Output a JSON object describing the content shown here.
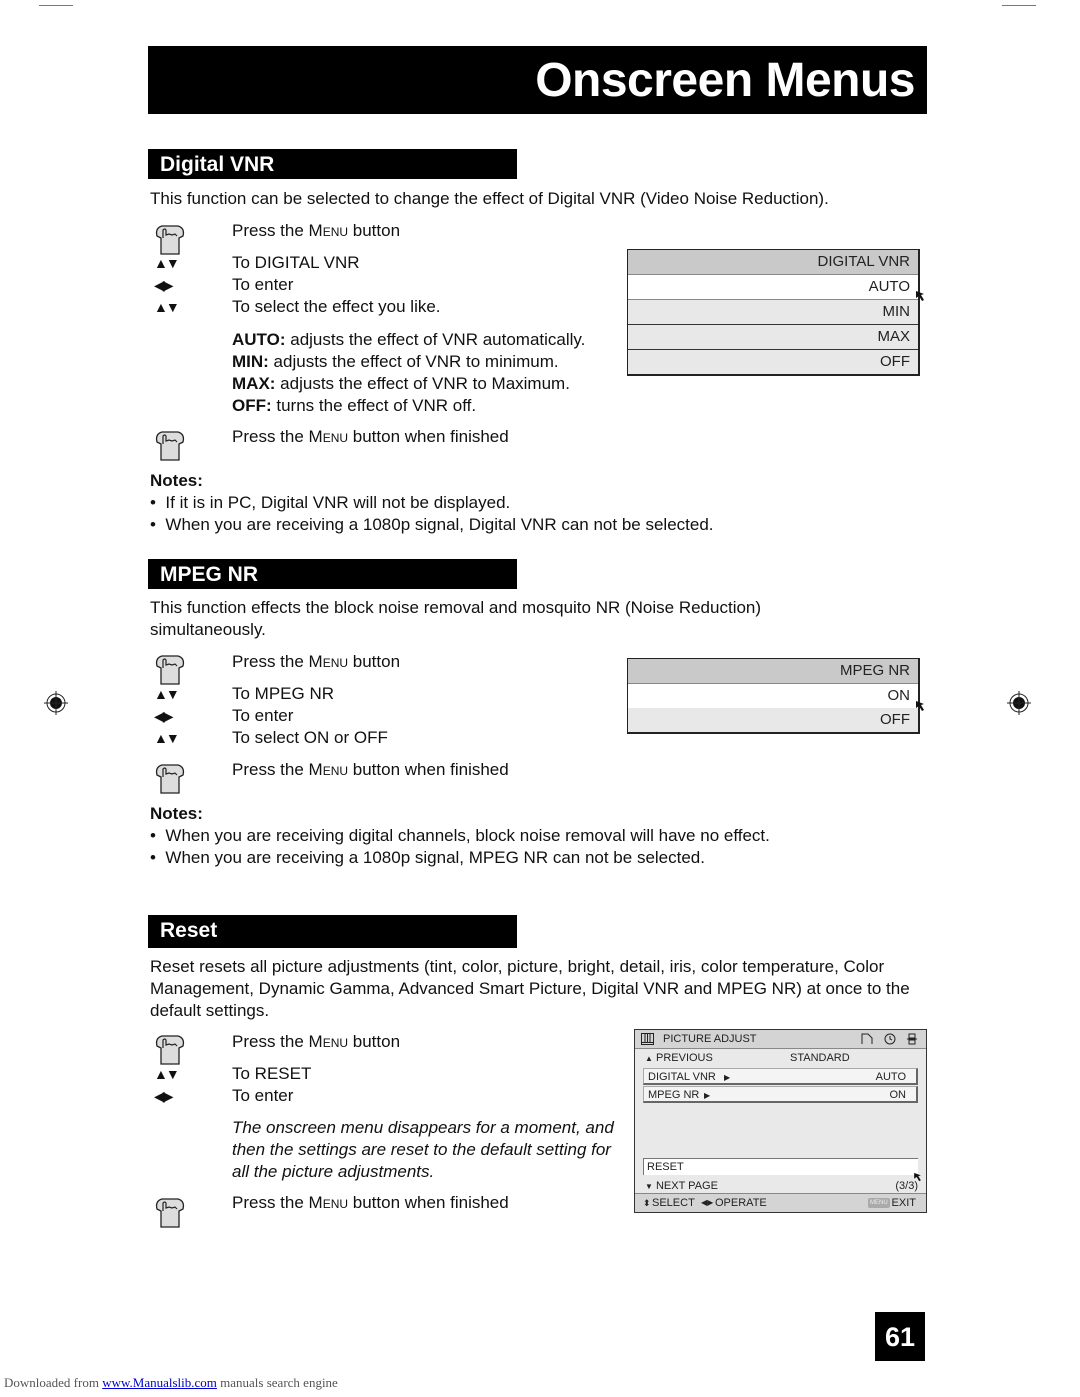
{
  "page": {
    "title": "Onscreen Menus",
    "page_number": "61",
    "footer": {
      "prefix": "Downloaded from ",
      "link": "www.Manualslib.com",
      "suffix": " manuals search engine"
    }
  },
  "common": {
    "press_menu_pre": "Press the ",
    "menu_word": "Menu",
    "press_menu_post": " button",
    "press_menu_finished_post": " button when finished",
    "to_enter": "To enter",
    "notes_heading": "Notes:",
    "bullet": "•"
  },
  "digital_vnr": {
    "heading": "Digital VNR",
    "intro": "This function can be selected to change the effect of Digital VNR (Video Noise Reduction).",
    "step_to": "To DIGITAL VNR",
    "step_select": "To select the effect you like.",
    "options": [
      {
        "term": "AUTO:",
        "desc": " adjusts the effect of VNR automatically."
      },
      {
        "term": "MIN:",
        "desc": " adjusts the effect of VNR to minimum."
      },
      {
        "term": "MAX:",
        "desc": " adjusts the effect of VNR to Maximum."
      },
      {
        "term": "OFF:",
        "desc": " turns the effect of VNR off."
      }
    ],
    "notes": [
      "If it is in PC, Digital VNR will not be displayed.",
      "When you are receiving a 1080p signal, Digital VNR can not be selected."
    ],
    "osd": {
      "title": "DIGITAL VNR",
      "items": [
        "AUTO",
        "MIN",
        "MAX",
        "OFF"
      ],
      "highlighted": "AUTO"
    }
  },
  "mpeg_nr": {
    "heading": "MPEG NR",
    "intro": "This function effects the block noise removal and mosquito NR (Noise Reduction) simultaneously.",
    "step_to": "To MPEG NR",
    "step_select": "To select ON or OFF",
    "notes": [
      "When you are receiving digital channels, block noise removal will have no effect.",
      "When you are receiving a 1080p signal, MPEG NR can not be selected."
    ],
    "osd": {
      "title": "MPEG NR",
      "items": [
        "ON",
        "OFF"
      ],
      "highlighted": "ON"
    }
  },
  "reset": {
    "heading": "Reset",
    "intro": "Reset resets all picture adjustments (tint, color, picture, bright, detail, iris, color temperature, Color Management, Dynamic Gamma, Advanced Smart Picture, Digital VNR and MPEG NR) at once to the default settings.",
    "step_to": "To RESET",
    "italic_note": "The onscreen menu disappears for a moment, and then the settings are reset to the default setting for all the picture adjustments.",
    "osd": {
      "title": "PICTURE ADJUST",
      "previous_label": "PREVIOUS",
      "previous_value": "STANDARD",
      "rows": [
        {
          "label": "DIGITAL VNR",
          "value": "AUTO"
        },
        {
          "label": "MPEG NR",
          "value": "ON"
        }
      ],
      "reset_label": "RESET",
      "next_page": "NEXT PAGE",
      "page_indicator": "(3/3)",
      "select_label": "SELECT",
      "operate_label": "OPERATE",
      "menu_badge": "MENU",
      "exit_label": "EXIT"
    }
  }
}
